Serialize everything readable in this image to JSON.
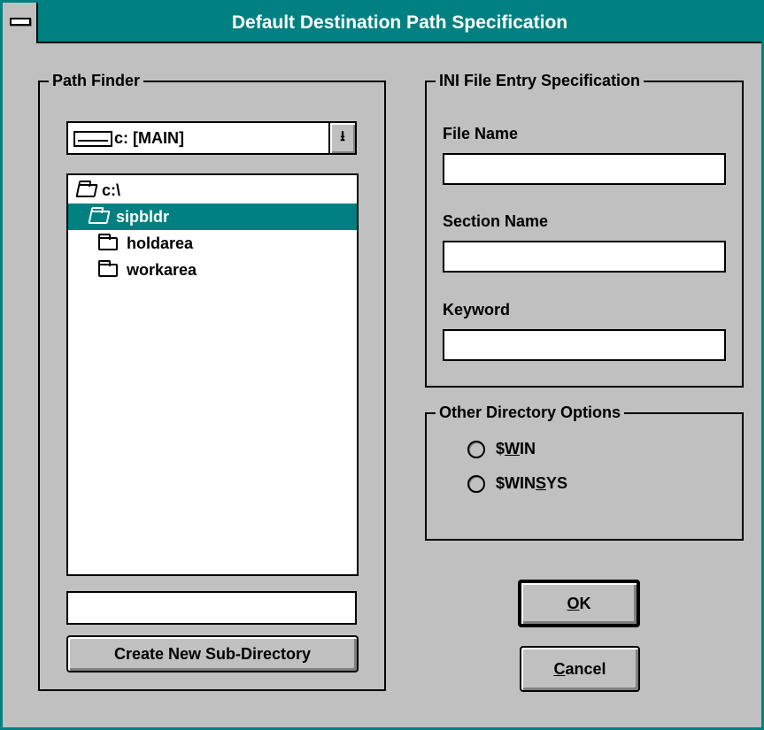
{
  "window": {
    "title": "Default Destination Path Specification"
  },
  "path_finder": {
    "legend": "Path Finder",
    "drive": "c: [MAIN]",
    "directories": [
      {
        "label": "c:\\",
        "state": "open",
        "selected": false
      },
      {
        "label": "sipbldr",
        "state": "open",
        "selected": true
      },
      {
        "label": "holdarea",
        "state": "closed",
        "selected": false
      },
      {
        "label": "workarea",
        "state": "closed",
        "selected": false
      }
    ],
    "new_dir_value": "",
    "create_button": "Create New Sub-Directory"
  },
  "ini": {
    "legend": "INI File Entry Specification",
    "file_name_label": "File Name",
    "file_name_value": "",
    "section_name_label": "Section Name",
    "section_name_value": "",
    "keyword_label": "Keyword",
    "keyword_value": ""
  },
  "other": {
    "legend": "Other Directory Options",
    "options": [
      {
        "prefix": "$",
        "mnemonic": "W",
        "rest": "IN",
        "selected": false
      },
      {
        "prefix": "$WIN",
        "mnemonic": "S",
        "rest": "YS",
        "selected": false
      }
    ]
  },
  "buttons": {
    "ok": {
      "mnemonic": "O",
      "rest": "K"
    },
    "cancel": {
      "mnemonic": "C",
      "rest": "ancel"
    }
  },
  "colors": {
    "titlebar": "#008080",
    "face": "#c0c0c0",
    "selection": "#008080"
  },
  "icons": [
    "system-menu-icon",
    "drive-icon",
    "dropdown-arrow-icon",
    "folder-open-icon",
    "folder-closed-icon"
  ]
}
